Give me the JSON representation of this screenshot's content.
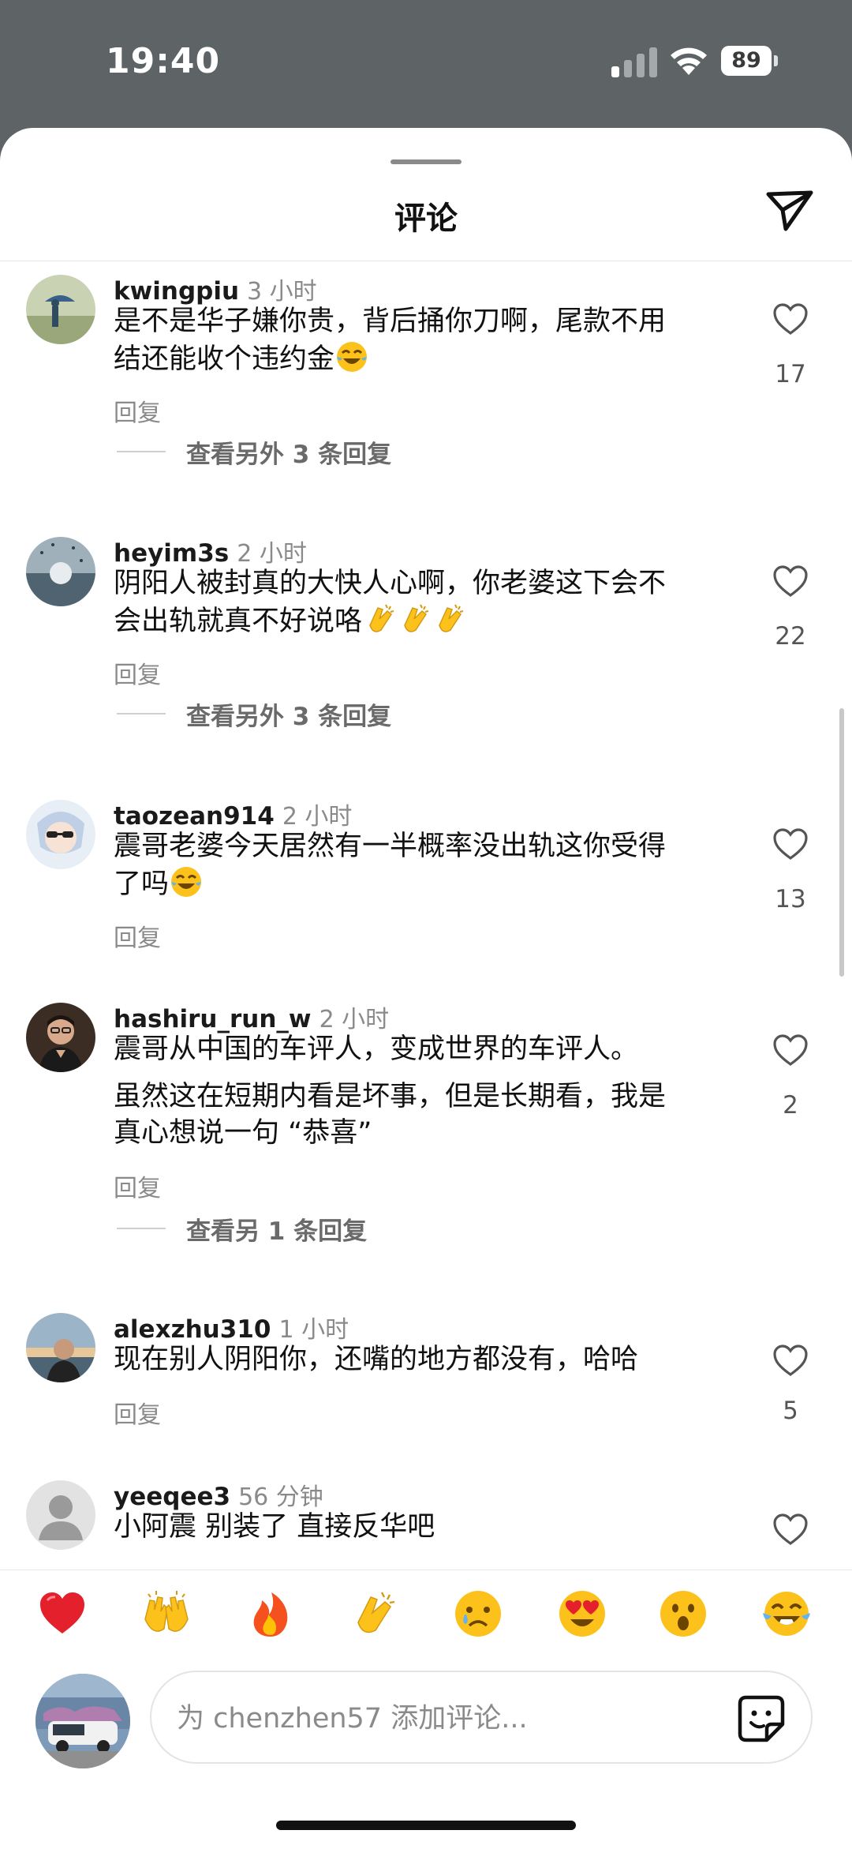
{
  "status_bar": {
    "time": "19:40",
    "battery": "89"
  },
  "sheet": {
    "title": "评论"
  },
  "comments": [
    {
      "username": "kwingpiu",
      "time": "3 小时",
      "text_line1": "是不是华子嫌你贵，背后捅你刀啊，尾款不用",
      "text_line2": "结还能收个违约金",
      "reply_label": "回复",
      "likes": "17",
      "view_more": "查看另外 3 条回复"
    },
    {
      "username": "heyim3s",
      "time": "2 小时",
      "text_line1": "阴阳人被封真的大快人心啊，你老婆这下会不",
      "text_line2": "会出轨就真不好说咯",
      "reply_label": "回复",
      "likes": "22",
      "view_more": "查看另外 3 条回复"
    },
    {
      "username": "taozean914",
      "time": "2 小时",
      "text_line1": "震哥老婆今天居然有一半概率没出轨这你受得",
      "text_line2": "了吗",
      "reply_label": "回复",
      "likes": "13"
    },
    {
      "username": "hashiru_run_w",
      "time": "2 小时",
      "text_line1": "震哥从中国的车评人，变成世界的车评人。",
      "text_line2": "虽然这在短期内看是坏事，但是长期看，我是",
      "text_line3": "真心想说一句 “恭喜”",
      "reply_label": "回复",
      "likes": "2",
      "view_more": "查看另 1 条回复"
    },
    {
      "username": "alexzhu310",
      "time": "1 小时",
      "text_line1": "现在别人阴阳你，还嘴的地方都没有，哈哈",
      "reply_label": "回复",
      "likes": "5"
    },
    {
      "username": "yeeqee3",
      "time": "56 分钟",
      "text_line1": "小阿震 别装了 直接反华吧"
    }
  ],
  "reactions": [
    "heart",
    "raising-hands",
    "fire",
    "clapping-hands",
    "crying-face",
    "heart-eyes-face",
    "surprised-face",
    "tears-of-joy-face"
  ],
  "composer": {
    "placeholder": "为 chenzhen57 添加评论..."
  },
  "colors": {
    "sheet_bg": "#ffffff",
    "backdrop": "#5e6366",
    "muted_text": "#8a8a8a"
  }
}
